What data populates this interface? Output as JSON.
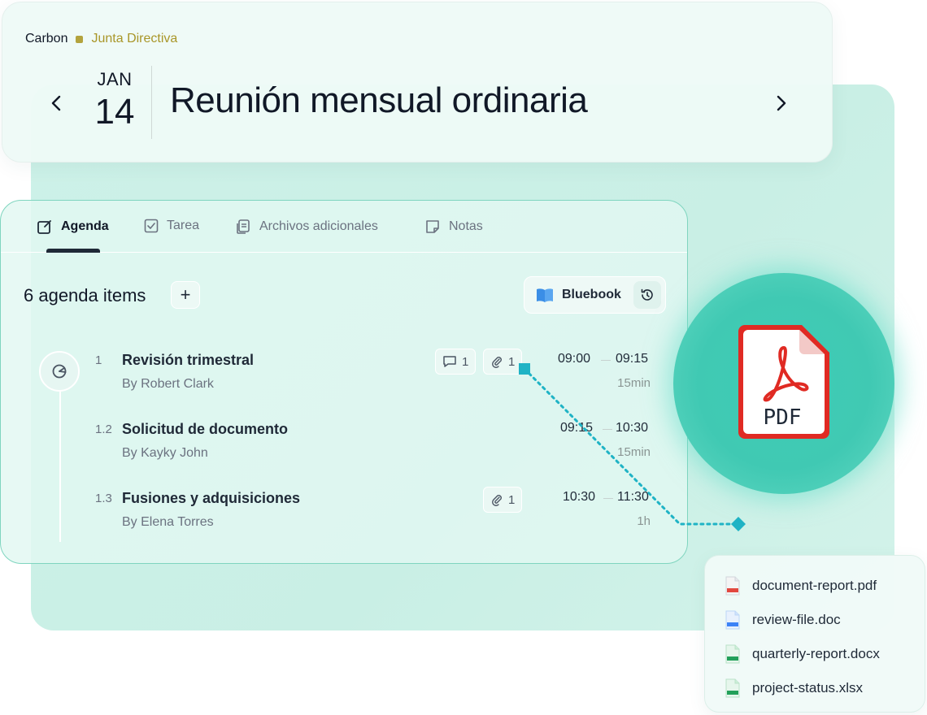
{
  "header": {
    "org_name": "Carbon",
    "board_name": "Junta Directiva",
    "board_color": "#b3a33d",
    "date_month": "JAN",
    "date_day": "14",
    "meeting_title": "Reunión mensual ordinaria"
  },
  "tabs": [
    {
      "label": "Agenda",
      "icon": "agenda-edit-icon",
      "active": true
    },
    {
      "label": "Tarea",
      "icon": "checkbox-icon",
      "active": false
    },
    {
      "label": "Archivos adicionales",
      "icon": "files-icon",
      "active": false
    },
    {
      "label": "Notas",
      "icon": "note-icon",
      "active": false
    }
  ],
  "agenda": {
    "count_label": "6 agenda items",
    "add_label": "+",
    "bluebook_label": "Bluebook",
    "items": [
      {
        "number": "1",
        "title": "Revisión trimestral",
        "by": "By Robert Clark",
        "comments": "1",
        "attachments": "1",
        "start": "09:00",
        "end": "09:15",
        "duration": "15min"
      },
      {
        "number": "1.2",
        "title": "Solicitud de documento",
        "by": "By Kayky John",
        "start": "09:15",
        "end": "10:30",
        "duration": "15min"
      },
      {
        "number": "1.3",
        "title": "Fusiones y adquisiciones",
        "by": "By Elena Torres",
        "attachments": "1",
        "start": "10:30",
        "end": "11:30",
        "duration": "1h"
      }
    ]
  },
  "pdf_badge": {
    "label": "PDF",
    "accent": "#e02a23"
  },
  "files": [
    {
      "name": "document-report.pdf",
      "icon": "pdf-file-icon",
      "tag": "PDF",
      "color": "#e2473f"
    },
    {
      "name": "review-file.doc",
      "icon": "doc-file-icon",
      "tag": "DOC",
      "color": "#3b82f6"
    },
    {
      "name": "quarterly-report.docx",
      "icon": "docx-file-icon",
      "tag": "DOCX",
      "color": "#22a05a"
    },
    {
      "name": "project-status.xlsx",
      "icon": "xlsx-file-icon",
      "tag": "XLSX",
      "color": "#22a05a"
    }
  ],
  "colors": {
    "accent": "#2bb8c4",
    "mint": "#c9efe5",
    "card_border": "#7fd5bf"
  }
}
